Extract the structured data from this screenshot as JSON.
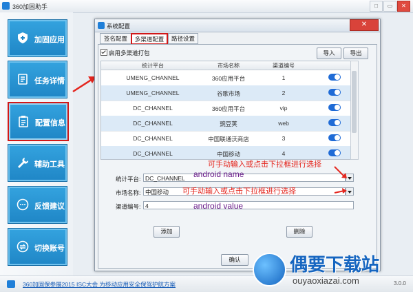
{
  "app": {
    "title": "360加固助手",
    "version": "3.0.0"
  },
  "window_controls": {
    "restore": "□",
    "minimize": "▭",
    "close": "✕"
  },
  "sidebar": {
    "items": [
      {
        "label": "加固应用",
        "icon": "shield-plus-icon"
      },
      {
        "label": "任务详情",
        "icon": "scroll-icon"
      },
      {
        "label": "配置信息",
        "icon": "clipboard-icon",
        "active": true
      },
      {
        "label": "辅助工具",
        "icon": "wrench-icon"
      },
      {
        "label": "反馈建议",
        "icon": "chat-bubble-icon"
      },
      {
        "label": "切换账号",
        "icon": "switch-account-icon"
      }
    ]
  },
  "status": {
    "link": "360加固保参展2015 ISC大会 为移动应用安全保驾护航方案"
  },
  "dialog": {
    "title": "系统配置",
    "close_label": "✕",
    "tabs": [
      "签名配置",
      "多渠道配置",
      "路径设置"
    ],
    "selected_tab": "多渠道配置",
    "enable_checkbox": {
      "label": "启用多渠道打包",
      "checked": true
    },
    "import_label": "导入",
    "export_label": "导出",
    "table": {
      "headers": [
        "统计平台",
        "市场名称",
        "渠道编号",
        ""
      ],
      "rows": [
        {
          "platform": "UMENG_CHANNEL",
          "market": "360应用平台",
          "code": "1",
          "enabled": true
        },
        {
          "platform": "UMENG_CHANNEL",
          "market": "谷歌市场",
          "code": "2",
          "enabled": true
        },
        {
          "platform": "DC_CHANNEL",
          "market": "360应用平台",
          "code": "vip",
          "enabled": true
        },
        {
          "platform": "DC_CHANNEL",
          "market": "豌豆荚",
          "code": "web",
          "enabled": true
        },
        {
          "platform": "DC_CHANNEL",
          "market": "中国联通沃商店",
          "code": "3",
          "enabled": true
        },
        {
          "platform": "DC_CHANNEL",
          "market": "中国移动",
          "code": "4",
          "enabled": true
        }
      ]
    },
    "form": {
      "platform_label": "统计平台:",
      "platform_value": "DC_CHANNEL",
      "market_label": "市场名称:",
      "market_value": "中国移动",
      "code_label": "渠道编号:",
      "code_value": "4"
    },
    "add_label": "添加",
    "delete_label": "删除",
    "confirm_label": "确认"
  },
  "annotations": {
    "hint1": "可手动输入或点击下拉框进行选择",
    "name": "android name",
    "hint2": "可手动输入或点击下拉框进行选择",
    "value": "android value"
  },
  "watermark": {
    "title": "偶要下载站",
    "url": "ouyaoxiazai.com"
  },
  "colors": {
    "accent": "#1f86c6",
    "highlight": "#d11818",
    "annotation_red": "#e4261e",
    "annotation_purple": "#6a1b8a"
  }
}
